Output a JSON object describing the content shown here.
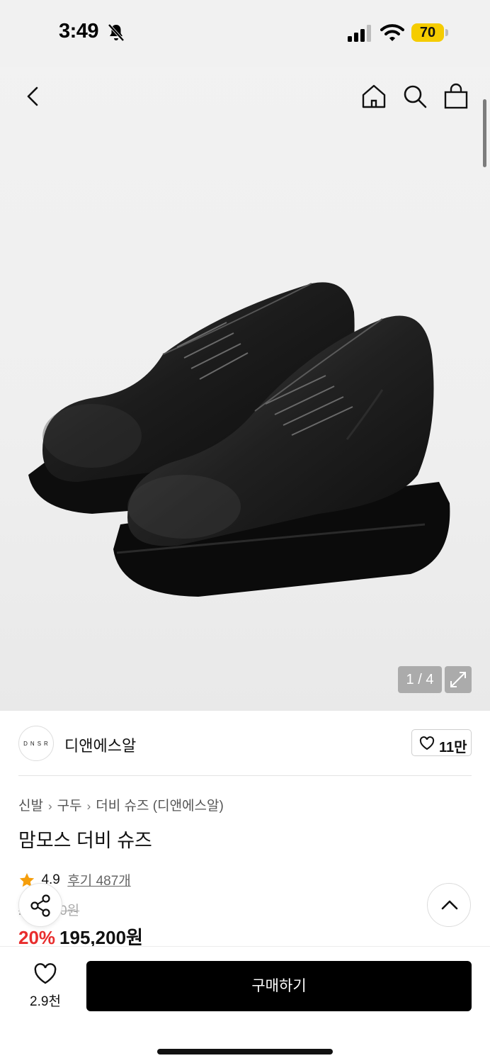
{
  "status_bar": {
    "time": "3:49",
    "battery": "70",
    "icons": [
      "bell-off-icon",
      "signal-icon",
      "wifi-icon",
      "battery-icon"
    ]
  },
  "nav": {
    "icons": [
      "back-icon",
      "home-icon",
      "search-icon",
      "bag-icon"
    ]
  },
  "gallery": {
    "page_counter": "1 / 4",
    "expand_icon": "expand-icon"
  },
  "brand": {
    "logo_text": "DNSR",
    "name": "디앤에스알",
    "likes": "11만"
  },
  "breadcrumb": {
    "items": [
      "신발",
      "구두",
      "더비 슈즈 (디앤에스알)"
    ]
  },
  "product": {
    "title": "맘모스 더비 슈즈",
    "rating": "4.9",
    "reviews": "후기 487개",
    "original_price": "244,000원",
    "discount": "20%",
    "sale_price": "195,200원"
  },
  "bottom_bar": {
    "wish_count": "2.9천",
    "buy_label": "구매하기"
  },
  "colors": {
    "accent_discount": "#e82d2d",
    "battery": "#f5cc00",
    "buy_button": "#000000",
    "star": "#f59e0b"
  }
}
